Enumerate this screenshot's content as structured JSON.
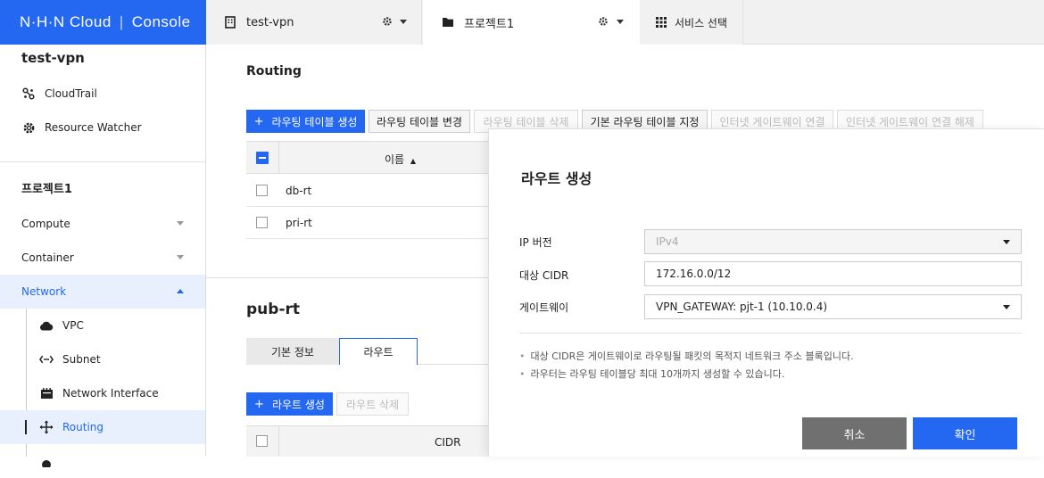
{
  "topbar": {
    "logo_brand": "N·H·N Cloud",
    "logo_sep": "|",
    "logo_console": "Console",
    "org_name": "test-vpn",
    "project_name": "프로젝트1",
    "service_select": "서비스 선택"
  },
  "sidebar": {
    "org_title": "test-vpn",
    "org_items": [
      "CloudTrail",
      "Resource Watcher"
    ],
    "project_title": "프로젝트1",
    "categories": [
      "Compute",
      "Container",
      "Network"
    ],
    "network_items": [
      "VPC",
      "Subnet",
      "Network Interface",
      "Routing",
      ""
    ],
    "active_item": "Routing"
  },
  "routing": {
    "heading": "Routing",
    "buttons": {
      "create": "라우팅 테이블 생성",
      "modify": "라우팅 테이블 변경",
      "delete": "라우팅 테이블 삭제",
      "set_default": "기본 라우팅 테이블 지정",
      "igw_connect": "인터넷 게이트웨이 연결",
      "igw_disconnect": "인터넷 게이트웨이 연결 해제"
    },
    "table_header_name": "이름",
    "rows": [
      "db-rt",
      "pri-rt"
    ]
  },
  "detail": {
    "title": "pub-rt",
    "tabs": [
      "기본 정보",
      "라우트"
    ],
    "active_tab": "라우트",
    "btn_create_route": "라우트 생성",
    "btn_delete_route": "라우트 삭제",
    "table_header_cidr": "CIDR"
  },
  "panel": {
    "title": "라우트 생성",
    "ip_version_label": "IP 버전",
    "ip_version_value": "IPv4",
    "cidr_label": "대상 CIDR",
    "cidr_value": "172.16.0.0/12",
    "gateway_label": "게이트웨이",
    "gateway_value": "VPN_GATEWAY: pjt-1 (10.10.0.4)",
    "notes": [
      "대상 CIDR은 게이트웨이로 라우팅될 패킷의 목적지 네트워크 주소 블록입니다.",
      "라우터는 라우팅 테이블당 최대 10개까지 생성할 수 있습니다."
    ],
    "cancel_label": "취소",
    "confirm_label": "확인"
  },
  "colors": {
    "brand": "#2467f0",
    "active_bg": "#e8f0fd",
    "cancel_btn": "#707070"
  }
}
